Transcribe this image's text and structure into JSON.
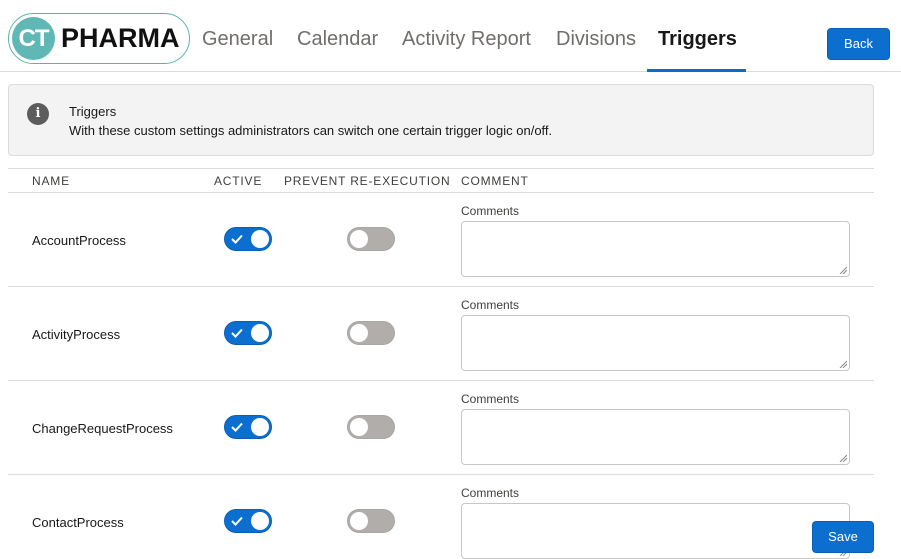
{
  "logo": {
    "mark": "CT",
    "name": "PHARMA"
  },
  "tabs": [
    {
      "label": "General",
      "active": false
    },
    {
      "label": "Calendar",
      "active": false
    },
    {
      "label": "Activity Report",
      "active": false
    },
    {
      "label": "Divisions",
      "active": false
    },
    {
      "label": "Triggers",
      "active": true
    }
  ],
  "header": {
    "back_label": "Back"
  },
  "info": {
    "icon": "info-icon",
    "title": "Triggers",
    "text": "With these custom settings administrators can switch one certain trigger logic on/off."
  },
  "table": {
    "columns": [
      "NAME",
      "ACTIVE",
      "PREVENT RE-EXECUTION",
      "COMMENT"
    ],
    "rows": [
      {
        "name": "AccountProcess",
        "active": true,
        "prevent": false,
        "comment_label": "Comments",
        "comment_value": ""
      },
      {
        "name": "ActivityProcess",
        "active": true,
        "prevent": false,
        "comment_label": "Comments",
        "comment_value": ""
      },
      {
        "name": "ChangeRequestProcess",
        "active": true,
        "prevent": false,
        "comment_label": "Comments",
        "comment_value": ""
      },
      {
        "name": "ContactProcess",
        "active": true,
        "prevent": false,
        "comment_label": "Comments",
        "comment_value": ""
      }
    ]
  },
  "footer": {
    "save_label": "Save"
  },
  "colors": {
    "accent": "#0c6fd0",
    "logo_teal": "#5fb8b5",
    "toggle_off": "#b0adab"
  }
}
